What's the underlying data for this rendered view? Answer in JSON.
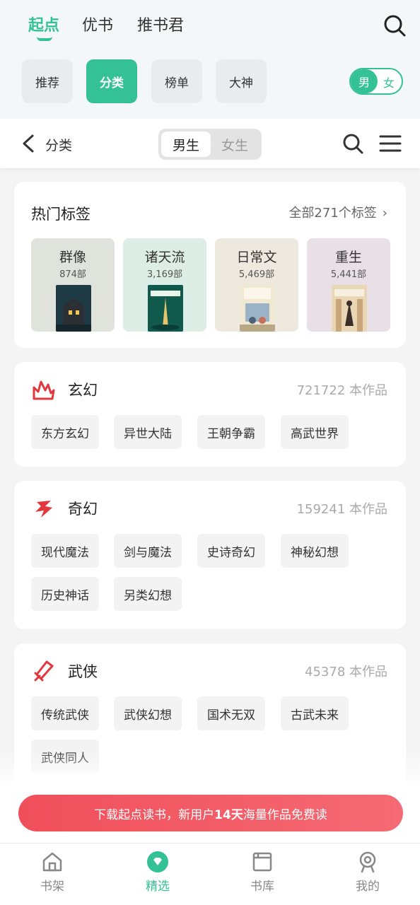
{
  "header": {
    "tabs": [
      {
        "label": "起点",
        "active": true
      },
      {
        "label": "优书",
        "active": false
      },
      {
        "label": "推书君",
        "active": false
      }
    ],
    "search_icon": "search-icon"
  },
  "chips": [
    {
      "label": "推荐",
      "active": false
    },
    {
      "label": "分类",
      "active": true
    },
    {
      "label": "榜单",
      "active": false
    },
    {
      "label": "大神",
      "active": false
    }
  ],
  "gender_toggle": {
    "on": "男",
    "off": "女"
  },
  "subbar": {
    "back_icon": "chevron-left-icon",
    "title": "分类",
    "segments": [
      {
        "label": "男生",
        "selected": true
      },
      {
        "label": "女生",
        "selected": false
      }
    ],
    "search_icon": "search-icon",
    "menu_icon": "menu-icon"
  },
  "hot_tags": {
    "title": "热门标签",
    "all_link": "全部271个标签",
    "tags": [
      {
        "name": "群像",
        "count": "874部",
        "bg": "#dfe3dc"
      },
      {
        "name": "诸天流",
        "count": "3,169部",
        "bg": "#ddeee6"
      },
      {
        "name": "日常文",
        "count": "5,469部",
        "bg": "#eee9de"
      },
      {
        "name": "重生",
        "count": "5,441部",
        "bg": "#e9dfe6"
      }
    ]
  },
  "categories": [
    {
      "name": "玄幻",
      "count": "721722 本作品",
      "icon": "xuanhuan-icon",
      "tags": [
        "东方玄幻",
        "异世大陆",
        "王朝争霸",
        "高武世界"
      ]
    },
    {
      "name": "奇幻",
      "count": "159241 本作品",
      "icon": "qihuan-icon",
      "tags": [
        "现代魔法",
        "剑与魔法",
        "史诗奇幻",
        "神秘幻想",
        "历史神话",
        "另类幻想"
      ]
    },
    {
      "name": "武侠",
      "count": "45378 本作品",
      "icon": "wuxia-icon",
      "tags": [
        "传统武侠",
        "武侠幻想",
        "国术无双",
        "古武未来",
        "武侠同人"
      ]
    }
  ],
  "promo": {
    "text_before": "下载起点读书，新用户",
    "highlight": "14天",
    "text_after": "海量作品免费读"
  },
  "bottom_nav": [
    {
      "label": "书架",
      "icon": "home-icon",
      "active": false
    },
    {
      "label": "精选",
      "icon": "diamond-icon",
      "active": true
    },
    {
      "label": "书库",
      "icon": "book-icon",
      "active": false
    },
    {
      "label": "我的",
      "icon": "profile-icon",
      "active": false
    }
  ],
  "colors": {
    "accent": "#34c193",
    "promo": "#f04f5a",
    "category_icon": "#e0383e"
  }
}
